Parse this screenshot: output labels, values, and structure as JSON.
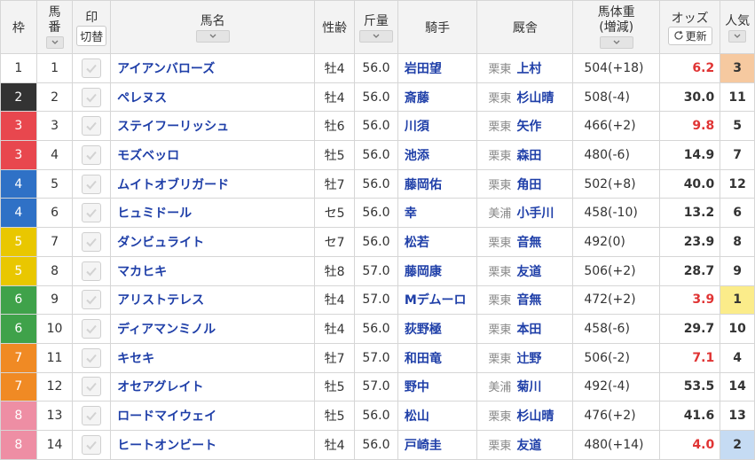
{
  "header": {
    "waku": "枠",
    "umaban_line1": "馬",
    "umaban_line2": "番",
    "mark": "印",
    "mark_toggle": "切替",
    "name": "馬名",
    "sexage": "性齢",
    "weight": "斤量",
    "jockey": "騎手",
    "trainer": "厩舎",
    "bodyweight_line1": "馬体重",
    "bodyweight_line2": "(増減)",
    "odds": "オッズ",
    "odds_refresh": "更新",
    "popularity": "人気"
  },
  "frame_colors": {
    "1": "#ffffff",
    "2": "#333333",
    "3": "#e8474e",
    "4": "#2f71c6",
    "5": "#e9c700",
    "6": "#3fa24a",
    "7": "#f08a24",
    "8": "#ee8ea4"
  },
  "rows": [
    {
      "waku": "1",
      "umaban": "1",
      "name": "アイアンバローズ",
      "sexage": "牡4",
      "weight": "56.0",
      "jockey": "岩田望",
      "region": "栗東",
      "trainer": "上村",
      "bodyweight": "504(+18)",
      "odds": "6.2",
      "hot": true,
      "pop": "3"
    },
    {
      "waku": "2",
      "umaban": "2",
      "name": "ペレヌス",
      "sexage": "牡4",
      "weight": "56.0",
      "jockey": "斎藤",
      "region": "栗東",
      "trainer": "杉山晴",
      "bodyweight": "508(-4)",
      "odds": "30.0",
      "hot": false,
      "pop": "11"
    },
    {
      "waku": "3",
      "umaban": "3",
      "name": "ステイフーリッシュ",
      "sexage": "牡6",
      "weight": "56.0",
      "jockey": "川須",
      "region": "栗東",
      "trainer": "矢作",
      "bodyweight": "466(+2)",
      "odds": "9.8",
      "hot": true,
      "pop": "5"
    },
    {
      "waku": "3",
      "umaban": "4",
      "name": "モズベッロ",
      "sexage": "牡5",
      "weight": "56.0",
      "jockey": "池添",
      "region": "栗東",
      "trainer": "森田",
      "bodyweight": "480(-6)",
      "odds": "14.9",
      "hot": false,
      "pop": "7"
    },
    {
      "waku": "4",
      "umaban": "5",
      "name": "ムイトオブリガード",
      "sexage": "牡7",
      "weight": "56.0",
      "jockey": "藤岡佑",
      "region": "栗東",
      "trainer": "角田",
      "bodyweight": "502(+8)",
      "odds": "40.0",
      "hot": false,
      "pop": "12"
    },
    {
      "waku": "4",
      "umaban": "6",
      "name": "ヒュミドール",
      "sexage": "セ5",
      "weight": "56.0",
      "jockey": "幸",
      "region": "美浦",
      "trainer": "小手川",
      "bodyweight": "458(-10)",
      "odds": "13.2",
      "hot": false,
      "pop": "6"
    },
    {
      "waku": "5",
      "umaban": "7",
      "name": "ダンビュライト",
      "sexage": "セ7",
      "weight": "56.0",
      "jockey": "松若",
      "region": "栗東",
      "trainer": "音無",
      "bodyweight": "492(0)",
      "odds": "23.9",
      "hot": false,
      "pop": "8"
    },
    {
      "waku": "5",
      "umaban": "8",
      "name": "マカヒキ",
      "sexage": "牡8",
      "weight": "57.0",
      "jockey": "藤岡康",
      "region": "栗東",
      "trainer": "友道",
      "bodyweight": "506(+2)",
      "odds": "28.7",
      "hot": false,
      "pop": "9"
    },
    {
      "waku": "6",
      "umaban": "9",
      "name": "アリストテレス",
      "sexage": "牡4",
      "weight": "57.0",
      "jockey": "Mデムーロ",
      "region": "栗東",
      "trainer": "音無",
      "bodyweight": "472(+2)",
      "odds": "3.9",
      "hot": true,
      "pop": "1"
    },
    {
      "waku": "6",
      "umaban": "10",
      "name": "ディアマンミノル",
      "sexage": "牡4",
      "weight": "56.0",
      "jockey": "荻野極",
      "region": "栗東",
      "trainer": "本田",
      "bodyweight": "458(-6)",
      "odds": "29.7",
      "hot": false,
      "pop": "10"
    },
    {
      "waku": "7",
      "umaban": "11",
      "name": "キセキ",
      "sexage": "牡7",
      "weight": "57.0",
      "jockey": "和田竜",
      "region": "栗東",
      "trainer": "辻野",
      "bodyweight": "506(-2)",
      "odds": "7.1",
      "hot": true,
      "pop": "4"
    },
    {
      "waku": "7",
      "umaban": "12",
      "name": "オセアグレイト",
      "sexage": "牡5",
      "weight": "57.0",
      "jockey": "野中",
      "region": "美浦",
      "trainer": "菊川",
      "bodyweight": "492(-4)",
      "odds": "53.5",
      "hot": false,
      "pop": "14"
    },
    {
      "waku": "8",
      "umaban": "13",
      "name": "ロードマイウェイ",
      "sexage": "牡5",
      "weight": "56.0",
      "jockey": "松山",
      "region": "栗東",
      "trainer": "杉山晴",
      "bodyweight": "476(+2)",
      "odds": "41.6",
      "hot": false,
      "pop": "13"
    },
    {
      "waku": "8",
      "umaban": "14",
      "name": "ヒートオンビート",
      "sexage": "牡4",
      "weight": "56.0",
      "jockey": "戸崎圭",
      "region": "栗東",
      "trainer": "友道",
      "bodyweight": "480(+14)",
      "odds": "4.0",
      "hot": true,
      "pop": "2"
    }
  ]
}
